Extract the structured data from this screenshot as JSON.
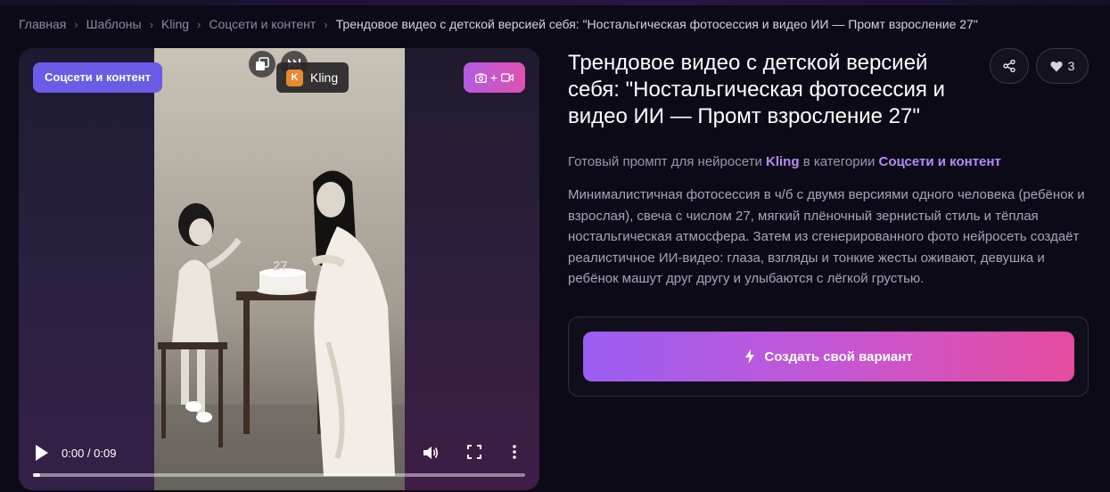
{
  "breadcrumb": {
    "items": [
      "Главная",
      "Шаблоны",
      "Kling",
      "Соцсети и контент"
    ],
    "current": "Трендовое видео с детской версией себя: \"Ностальгическая фотосессия и видео ИИ — Промт взросление 27\""
  },
  "media": {
    "category_chip": "Соцсети и контент",
    "model_chip": "Kling",
    "model_logo_letter": "K",
    "mode_plus": "+",
    "cake_number": "27",
    "video": {
      "time": "0:00 / 0:09",
      "progress": 0.015
    }
  },
  "header": {
    "title": "Трендовое видео с детской версией себя: \"Ностальгическая фотосессия и видео ИИ — Промт взросление 27\"",
    "likes": "3"
  },
  "subtitle": {
    "prefix": "Готовый промпт для нейросети",
    "model": "Kling",
    "middle": "в категории",
    "category": "Соцсети и контент"
  },
  "description": "Минималистичная фотосессия в ч/б с двумя версиями одного человека (ребёнок и взрослая), свеча с числом 27, мягкий плёночный зернистый стиль и тёплая ностальгическая атмосфера. Затем из сгенерированного фото нейросеть создаёт реалистичное ИИ-видео: глаза, взгляды и тонкие жесты оживают, девушка и ребёнок машут друг другу и улыбаются с лёгкой грустью.",
  "cta": {
    "label": "Создать свой вариант"
  },
  "icons": {
    "share": "share-icon",
    "like": "heart-icon",
    "copy": "copy-icon",
    "next": "skip-next-icon",
    "camera": "camera-icon",
    "video": "video-icon",
    "bolt": "lightning-icon",
    "play": "play-icon",
    "volume": "volume-icon",
    "fullscreen": "fullscreen-icon",
    "more": "more-vertical-icon"
  },
  "colors": {
    "accent_purple": "#6a5ce6",
    "highlight": "#b68cf5",
    "cta_gradient_start": "#9a5ef2",
    "cta_gradient_end": "#e64b9e"
  }
}
